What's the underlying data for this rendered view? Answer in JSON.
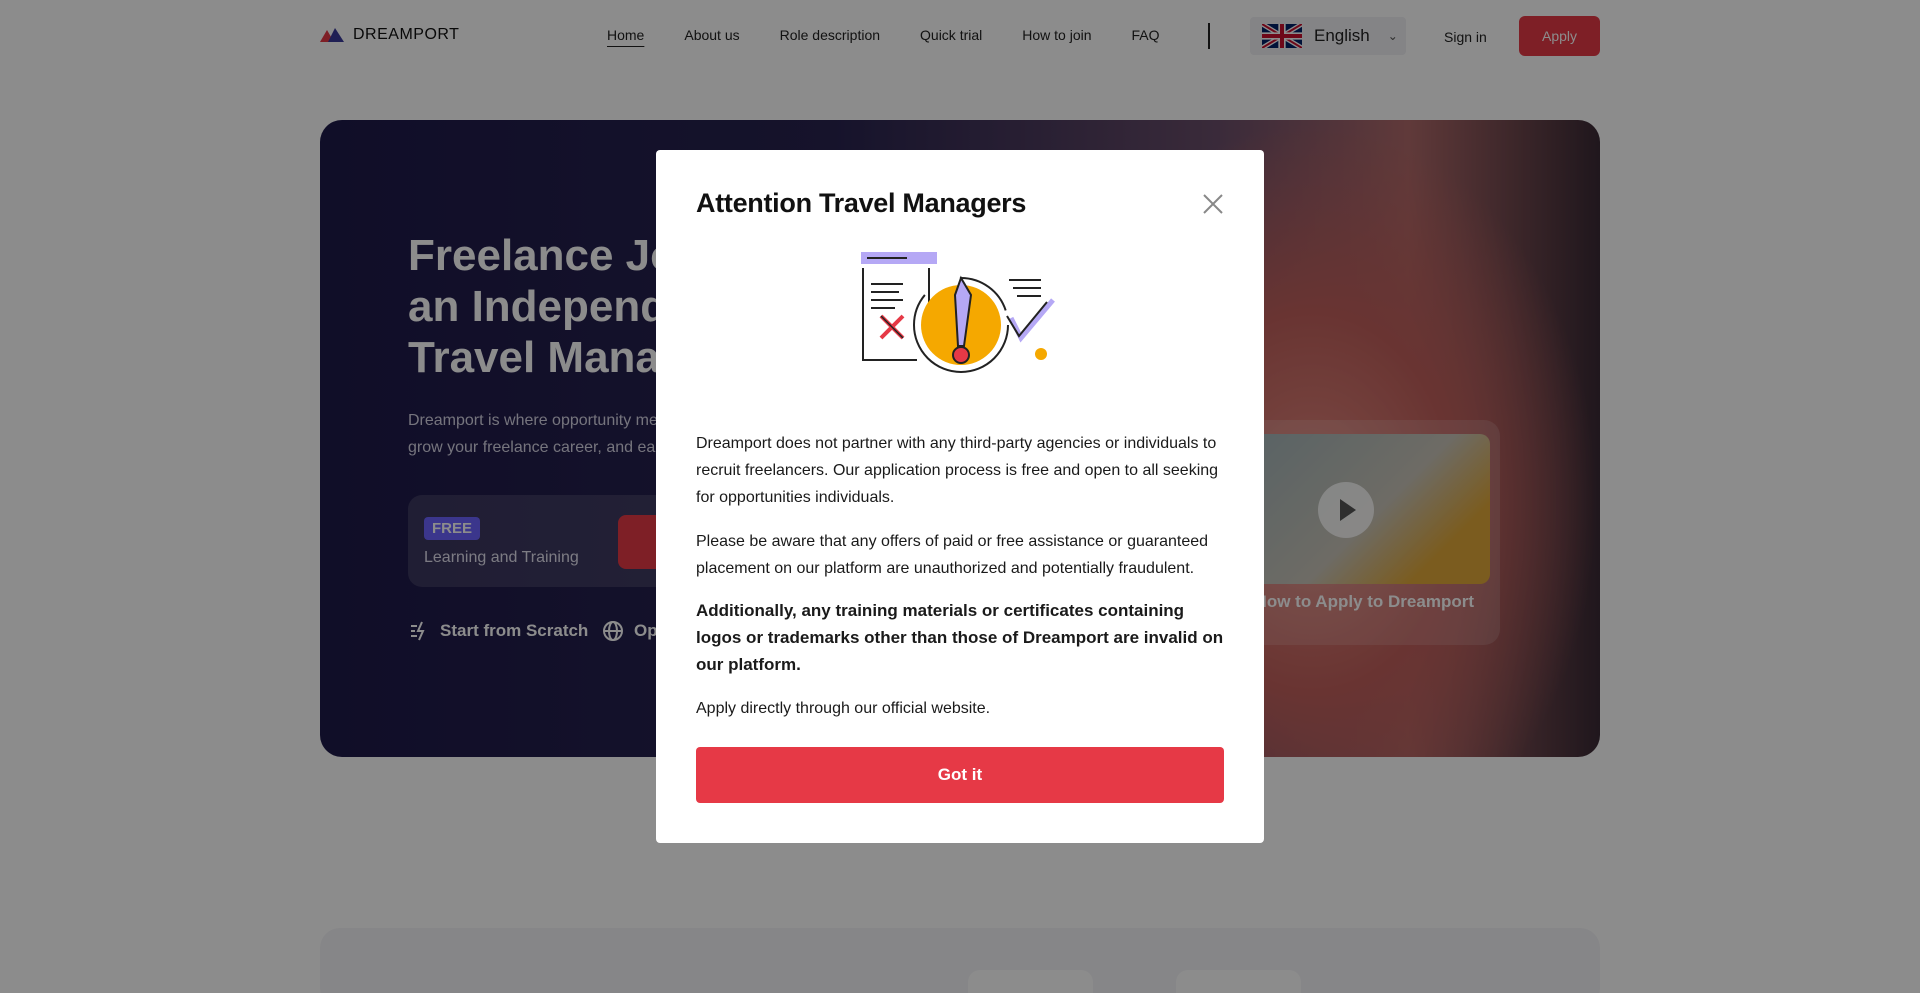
{
  "header": {
    "brand": "DREAMPORT",
    "nav": [
      "Home",
      "About us",
      "Role description",
      "Quick trial",
      "How to join",
      "FAQ"
    ],
    "language": "English",
    "sign_in": "Sign in",
    "apply": "Apply"
  },
  "hero": {
    "title_lines": [
      "Freelance Jo",
      "an Independ",
      "Travel Manag"
    ],
    "subtitle_lines": [
      "Dreamport is where opportunity me",
      "grow your freelance career, and ear"
    ],
    "free_badge": "FREE",
    "free_label": "Learning and Training",
    "features": [
      "Start from Scratch",
      "Op"
    ],
    "video_label": "ch How to Apply to Dreamport"
  },
  "modal": {
    "title": "Attention Travel Managers",
    "paragraphs": [
      "Dreamport does not partner with any third-party agencies or individuals to recruit freelancers. Our application process is free and open to all seeking for opportunities individuals.",
      "Please be aware that any offers of paid or free assistance or guaranteed placement on our platform are unauthorized and potentially fraudulent.",
      "Additionally, any training materials or certificates containing logos or trademarks other than those of Dreamport are invalid on our platform.",
      "Apply directly through our official website."
    ],
    "button": "Got it"
  },
  "colors": {
    "accent": "#e63946",
    "hero_bg": "#1e1a4a",
    "badge": "#6c63ff",
    "warning_yellow": "#f5a800",
    "illustration_purple": "#b5a8f5"
  },
  "icons": [
    "logo-icon",
    "uk-flag-icon",
    "chevron-down-icon",
    "close-icon",
    "warning-illustration",
    "play-icon",
    "lightning-icon",
    "globe-icon"
  ]
}
